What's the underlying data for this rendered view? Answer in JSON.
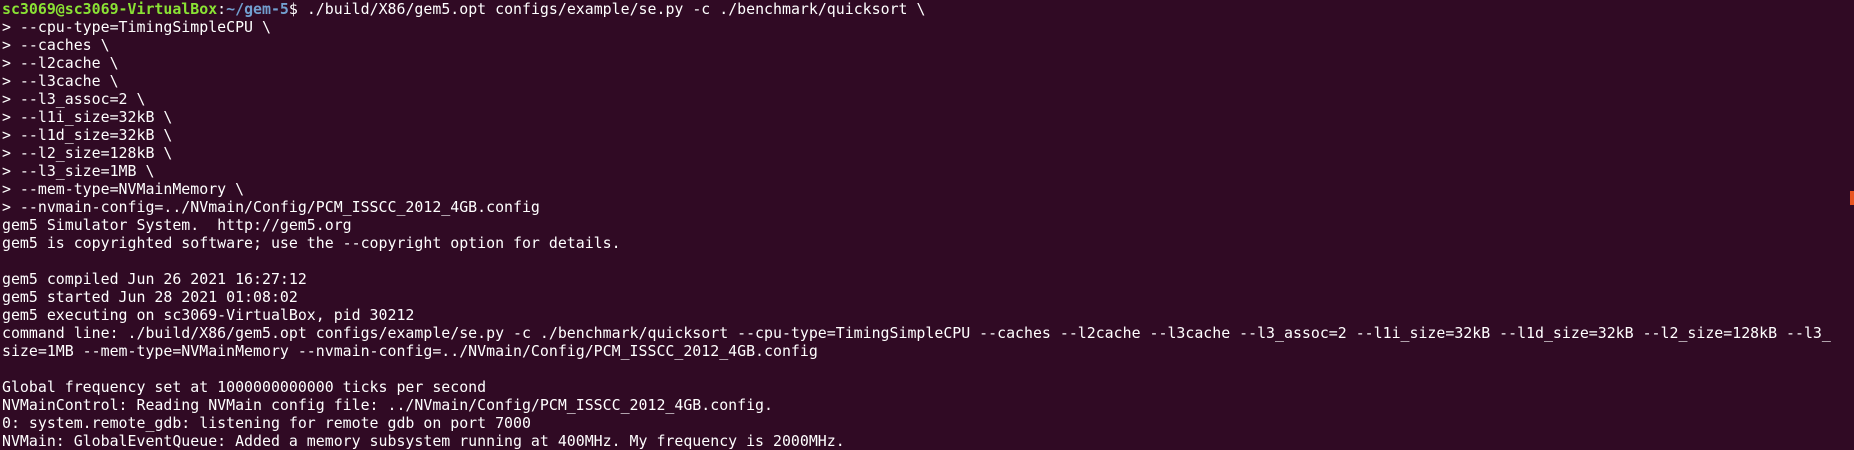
{
  "terminal": {
    "prompt": {
      "user_host": "sc3069@sc3069-VirtualBox",
      "colon": ":",
      "path": "~/gem-5",
      "symbol": "$ ",
      "command": "./build/X86/gem5.opt configs/example/se.py -c ./benchmark/quicksort \\"
    },
    "lines": [
      "> --cpu-type=TimingSimpleCPU \\",
      "> --caches \\",
      "> --l2cache \\",
      "> --l3cache \\",
      "> --l3_assoc=2 \\",
      "> --l1i_size=32kB \\",
      "> --l1d_size=32kB \\",
      "> --l2_size=128kB \\",
      "> --l3_size=1MB \\",
      "> --mem-type=NVMainMemory \\",
      "> --nvmain-config=../NVmain/Config/PCM_ISSCC_2012_4GB.config",
      "gem5 Simulator System.  http://gem5.org",
      "gem5 is copyrighted software; use the --copyright option for details.",
      "",
      "gem5 compiled Jun 26 2021 16:27:12",
      "gem5 started Jun 28 2021 01:08:02",
      "gem5 executing on sc3069-VirtualBox, pid 30212",
      "command line: ./build/X86/gem5.opt configs/example/se.py -c ./benchmark/quicksort --cpu-type=TimingSimpleCPU --caches --l2cache --l3cache --l3_assoc=2 --l1i_size=32kB --l1d_size=32kB --l2_size=128kB --l3_",
      "size=1MB --mem-type=NVMainMemory --nvmain-config=../NVmain/Config/PCM_ISSCC_2012_4GB.config",
      "",
      "Global frequency set at 1000000000000 ticks per second",
      "NVMainControl: Reading NVMain config file: ../NVmain/Config/PCM_ISSCC_2012_4GB.config.",
      "0: system.remote_gdb: listening for remote gdb on port 7000",
      "NVMain: GlobalEventQueue: Added a memory subsystem running at 400MHz. My frequency is 2000MHz."
    ]
  },
  "colors": {
    "background": "#300a24",
    "text": "#ffffff",
    "user_host": "#8ae234",
    "path": "#729fcf",
    "scroll_marker": "#e95420"
  }
}
